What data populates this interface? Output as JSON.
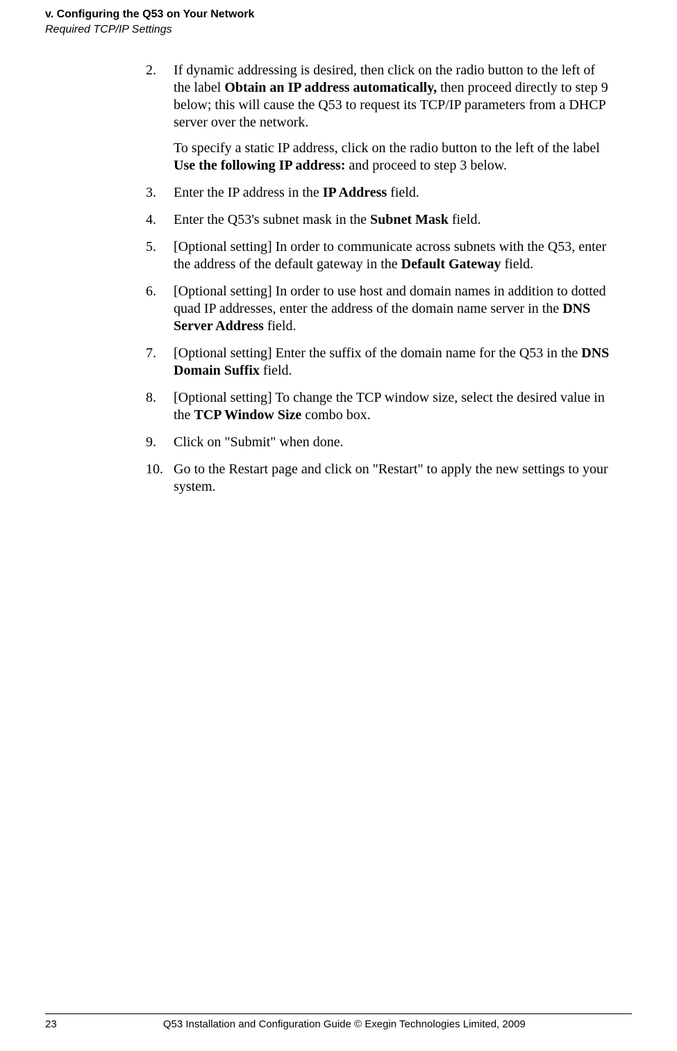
{
  "header": {
    "chapter": "v. Configuring the Q53 on Your Network",
    "section": "Required TCP/IP Settings"
  },
  "steps": [
    {
      "num": "2.",
      "paragraphs": [
        {
          "runs": [
            {
              "t": "If dynamic addressing is desired, then click on the radio button to the left of the label "
            },
            {
              "t": "Obtain an IP address automatically,",
              "b": true
            },
            {
              "t": " then proceed directly to step 9 below; this will cause the Q53 to request its TCP/IP parameters from a DHCP server over the network."
            }
          ]
        },
        {
          "runs": [
            {
              "t": "To specify a static IP address, click on the radio button to the left of the label "
            },
            {
              "t": "Use the following IP address:",
              "b": true
            },
            {
              "t": " and proceed to step 3 below."
            }
          ]
        }
      ]
    },
    {
      "num": "3.",
      "paragraphs": [
        {
          "runs": [
            {
              "t": "Enter the IP address in the "
            },
            {
              "t": "IP Address",
              "b": true
            },
            {
              "t": " field."
            }
          ]
        }
      ]
    },
    {
      "num": "4.",
      "paragraphs": [
        {
          "runs": [
            {
              "t": "Enter the Q53's subnet mask in the "
            },
            {
              "t": "Subnet Mask",
              "b": true
            },
            {
              "t": " field."
            }
          ]
        }
      ]
    },
    {
      "num": "5.",
      "paragraphs": [
        {
          "runs": [
            {
              "t": "[Optional setting] In order to communicate across subnets with the Q53, enter the address of the default gateway in the "
            },
            {
              "t": "Default Gateway",
              "b": true
            },
            {
              "t": " field."
            }
          ]
        }
      ]
    },
    {
      "num": "6.",
      "paragraphs": [
        {
          "runs": [
            {
              "t": "[Optional setting] In order to use host and domain names in addition to dotted quad IP addresses, enter the address of the domain name server in the "
            },
            {
              "t": "DNS Server Address",
              "b": true
            },
            {
              "t": " field."
            }
          ]
        }
      ]
    },
    {
      "num": "7.",
      "paragraphs": [
        {
          "runs": [
            {
              "t": "[Optional setting] Enter the suffix of the domain name for the Q53 in the "
            },
            {
              "t": "DNS Domain Suffix",
              "b": true
            },
            {
              "t": " field."
            }
          ]
        }
      ]
    },
    {
      "num": "8.",
      "paragraphs": [
        {
          "runs": [
            {
              "t": "[Optional setting] To change the TCP window size, select the desired value in the "
            },
            {
              "t": "TCP Window Size",
              "b": true
            },
            {
              "t": " combo box."
            }
          ]
        }
      ]
    },
    {
      "num": "9.",
      "paragraphs": [
        {
          "runs": [
            {
              "t": "Click on \"Submit\" when done."
            }
          ]
        }
      ]
    },
    {
      "num": "10.",
      "paragraphs": [
        {
          "runs": [
            {
              "t": "Go to the Restart page and click on \"Restart\" to apply the new settings to your system."
            }
          ]
        }
      ]
    }
  ],
  "footer": {
    "page": "23",
    "text": "Q53 Installation and Configuration Guide  © Exegin Technologies Limited, 2009"
  }
}
